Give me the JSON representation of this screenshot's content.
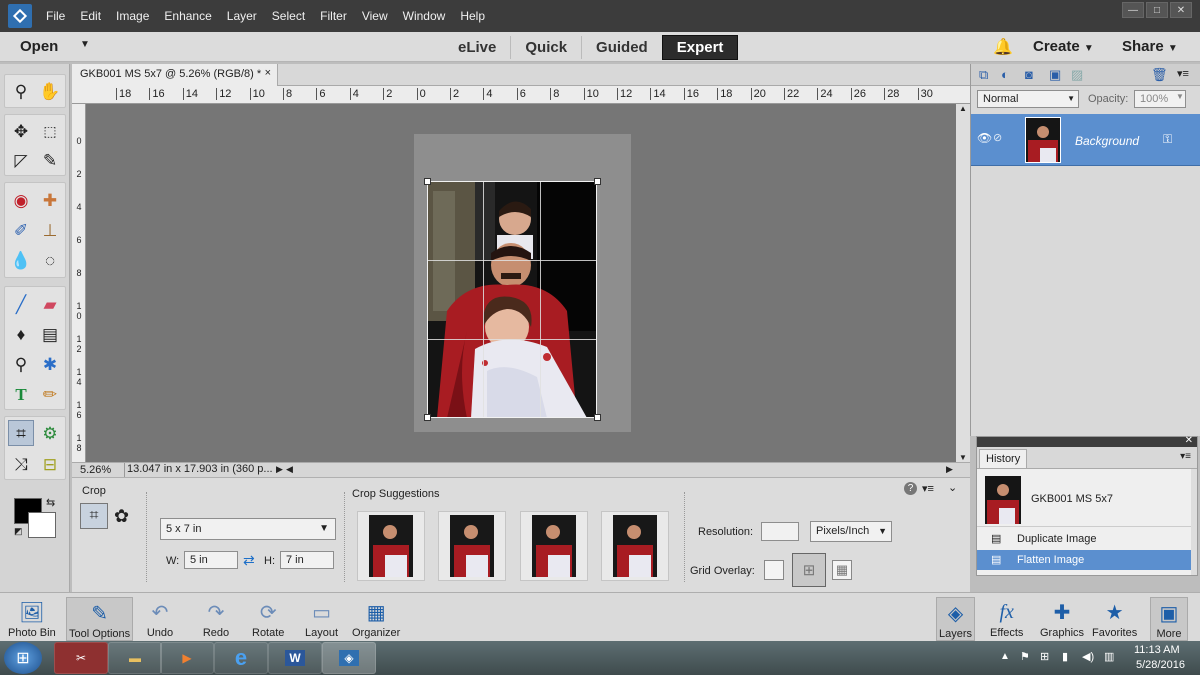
{
  "menubar": {
    "items": [
      "File",
      "Edit",
      "Image",
      "Enhance",
      "Layer",
      "Select",
      "Filter",
      "View",
      "Window",
      "Help"
    ],
    "window_buttons": [
      "—",
      "□",
      "✕"
    ]
  },
  "modebar": {
    "open_label": "Open",
    "modes": [
      "eLive",
      "Quick",
      "Guided",
      "Expert"
    ],
    "active_mode": "Expert",
    "create_label": "Create",
    "share_label": "Share"
  },
  "document": {
    "tab_title": "GKB001 MS 5x7 @ 5.26% (RGB/8) *",
    "tab_close": "×",
    "zoom": "5.26%",
    "dimensions": "13.047 in x 17.903 in (360 p..."
  },
  "rulers": {
    "horizontal": [
      "18",
      "16",
      "14",
      "12",
      "10",
      "8",
      "6",
      "4",
      "2",
      "0",
      "2",
      "4",
      "6",
      "8",
      "10",
      "12",
      "14",
      "16",
      "18",
      "20",
      "22",
      "24",
      "26",
      "28",
      "30"
    ],
    "vertical": [
      "0",
      "2",
      "4",
      "6",
      "8",
      "1\n0",
      "1\n2",
      "1\n4",
      "1\n6",
      "1\n8"
    ]
  },
  "tool_options": {
    "section_label": "Crop",
    "suggestions_label": "Crop Suggestions",
    "ratio_value": "5 x 7 in",
    "width_label": "W:",
    "width_value": "5 in",
    "height_label": "H:",
    "height_value": "7 in",
    "resolution_label": "Resolution:",
    "resolution_value": "",
    "units_value": "Pixels/Inch",
    "grid_overlay_label": "Grid Overlay:"
  },
  "layers": {
    "blend_mode": "Normal",
    "opacity_label": "Opacity:",
    "opacity_value": "100%",
    "layer_name": "Background"
  },
  "history": {
    "tab_label": "History",
    "snapshot_name": "GKB001 MS 5x7",
    "steps": [
      "Duplicate Image",
      "Flatten Image"
    ]
  },
  "bottom_bar": {
    "left": [
      "Photo Bin",
      "Tool Options",
      "Undo",
      "Redo",
      "Rotate",
      "Layout",
      "Organizer"
    ],
    "right": [
      "Layers",
      "Effects",
      "Graphics",
      "Favorites",
      "More"
    ]
  },
  "taskbar": {
    "time": "11:13 AM",
    "date": "5/28/2016"
  },
  "colors": {
    "accent": "#1d6fc8",
    "active_mode_bg": "#2c2c2c",
    "layer_selected": "#5b8fcf",
    "history_selected": "#5b8fcf"
  }
}
